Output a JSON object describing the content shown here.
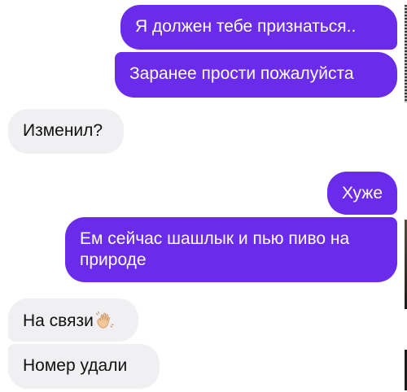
{
  "messages": [
    {
      "direction": "outgoing",
      "text": "Я должен тебе признаться.."
    },
    {
      "direction": "outgoing",
      "text": "Заранее прости пожалуйста"
    },
    {
      "direction": "incoming",
      "text": "Изменил?"
    },
    {
      "direction": "outgoing",
      "text": "Хуже"
    },
    {
      "direction": "outgoing",
      "text": "Ем сейчас шашлык и пью пиво на природе"
    },
    {
      "direction": "incoming",
      "text": "На связи",
      "emoji": "waving-hand-icon"
    },
    {
      "direction": "incoming",
      "text": "Номер удали"
    }
  ],
  "colors": {
    "outgoing_bubble": "#6a2bea",
    "incoming_bubble": "#f0f0f2",
    "outgoing_text": "#ffffff",
    "incoming_text": "#111111"
  }
}
